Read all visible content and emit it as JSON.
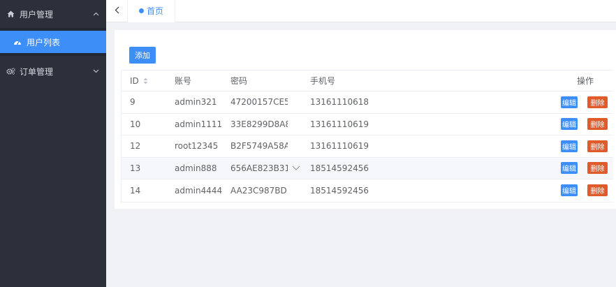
{
  "sidebar": {
    "groups": [
      {
        "label": "用户管理",
        "icon": "home-icon",
        "expanded": true,
        "items": [
          {
            "label": "用户列表",
            "icon": "dashboard-icon",
            "active": true
          }
        ]
      },
      {
        "label": "订单管理",
        "icon": "gears-icon",
        "expanded": false
      }
    ]
  },
  "tabs": [
    {
      "label": "首页",
      "active": true
    }
  ],
  "toolbar": {
    "add_label": "添加"
  },
  "table": {
    "headers": {
      "id": "ID",
      "account": "账号",
      "password": "密码",
      "phone": "手机号",
      "ops": "操作"
    },
    "edit_label": "编辑",
    "delete_label": "删除",
    "rows": [
      {
        "id": "9",
        "account": "admin321",
        "password": "47200157CE5...",
        "phone": "13161110618"
      },
      {
        "id": "10",
        "account": "admin1111",
        "password": "33E8299D8A8...",
        "phone": "13161110619"
      },
      {
        "id": "12",
        "account": "root12345",
        "password": "B2F5749A58A...",
        "phone": "13161110619"
      },
      {
        "id": "13",
        "account": "admin888",
        "password": "656AE823B31...",
        "phone": "18514592456"
      },
      {
        "id": "14",
        "account": "admin4444",
        "password": "AA23C987BD...",
        "phone": "18514592456"
      }
    ]
  },
  "colors": {
    "sidebar_bg": "#2b303b",
    "accent": "#3e8ef7",
    "danger": "#e15b2a"
  }
}
